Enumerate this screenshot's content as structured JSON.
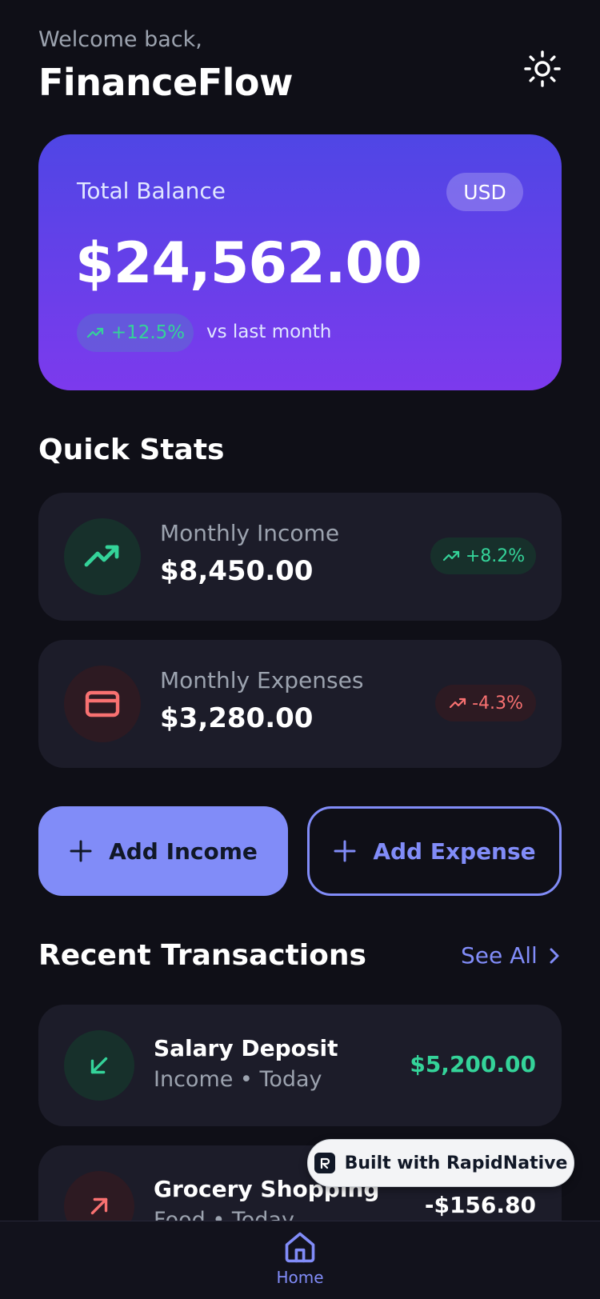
{
  "header": {
    "welcome": "Welcome back,",
    "title": "FinanceFlow",
    "theme_icon": "sun-icon"
  },
  "balance": {
    "label": "Total Balance",
    "currency": "USD",
    "amount": "$24,562.00",
    "change": "+12.5%",
    "change_note": "vs last month"
  },
  "quick_stats": {
    "title": "Quick Stats",
    "items": [
      {
        "label": "Monthly Income",
        "value": "$8,450.00",
        "change": "+8.2%",
        "icon": "trending-up-icon",
        "color": "#34d399"
      },
      {
        "label": "Monthly Expenses",
        "value": "$3,280.00",
        "change": "-4.3%",
        "icon": "credit-card-icon",
        "color": "#f87171"
      }
    ]
  },
  "actions": {
    "add_income": "Add Income",
    "add_expense": "Add Expense"
  },
  "transactions": {
    "title": "Recent Transactions",
    "see_all": "See All",
    "items": [
      {
        "title": "Salary Deposit",
        "meta": "Income • Today",
        "amount": "$5,200.00",
        "type": "income"
      },
      {
        "title": "Grocery Shopping",
        "meta": "Food • Today",
        "amount": "-$156.80",
        "type": "expense"
      }
    ]
  },
  "badge": {
    "text": "Built with RapidNative"
  },
  "nav": {
    "home": "Home"
  },
  "colors": {
    "accent": "#818cf8",
    "positive": "#34d399",
    "negative": "#f87171",
    "background": "#0f0f17",
    "card": "#1c1c29"
  }
}
